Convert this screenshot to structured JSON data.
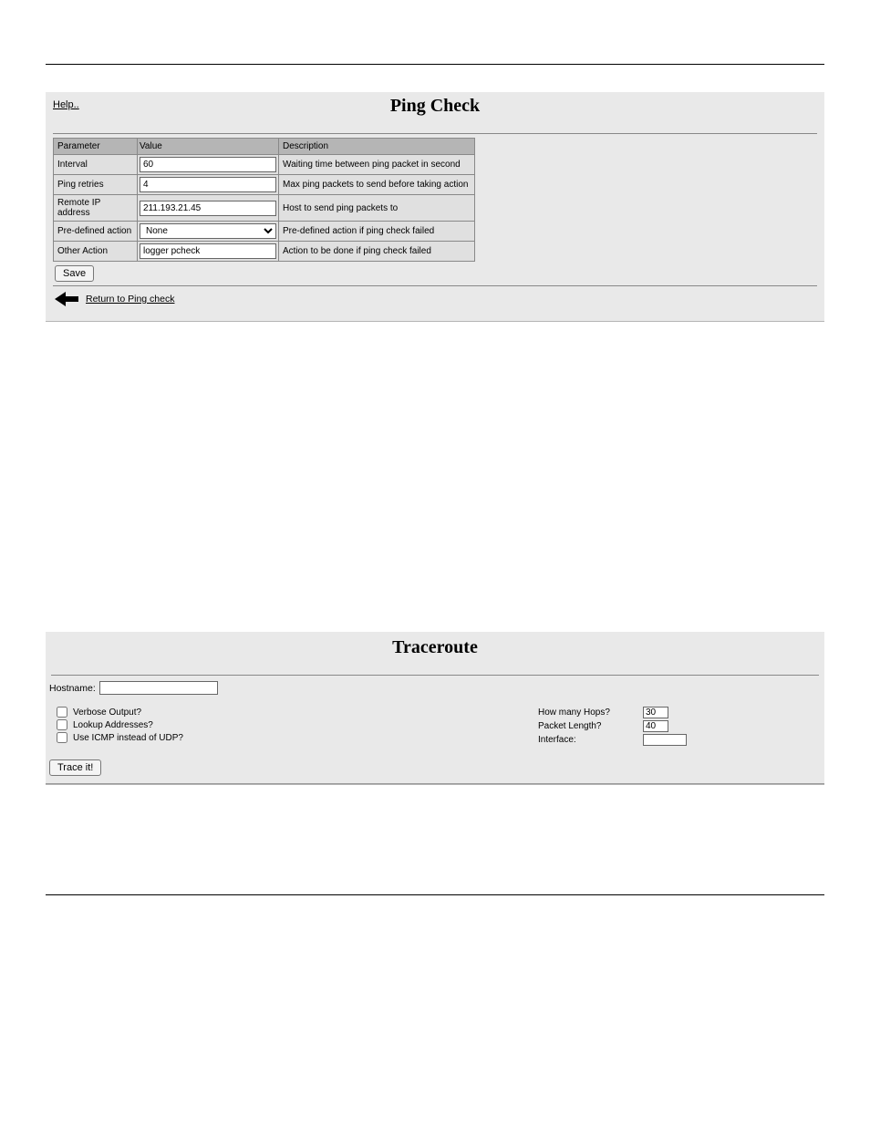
{
  "ping": {
    "help": "Help..",
    "title": "Ping Check",
    "headers": {
      "param": "Parameter",
      "value": "Value",
      "desc": "Description"
    },
    "rows": [
      {
        "param": "Interval",
        "value": "60",
        "type": "text",
        "desc": "Waiting time between ping packet in second"
      },
      {
        "param": "Ping retries",
        "value": "4",
        "type": "text",
        "desc": "Max ping packets to send before taking action"
      },
      {
        "param": "Remote IP address",
        "value": "211.193.21.45",
        "type": "text",
        "desc": "Host to send ping packets to"
      },
      {
        "param": "Pre-defined action",
        "value": "None",
        "type": "select",
        "desc": "Pre-defined action if ping check failed"
      },
      {
        "param": "Other Action",
        "value": "logger pcheck",
        "type": "text",
        "desc": "Action to be done if ping check failed"
      }
    ],
    "save": "Save",
    "return": "Return to Ping check"
  },
  "trace": {
    "title": "Traceroute",
    "hostname_label": "Hostname:",
    "hostname_value": "",
    "cb_verbose": "Verbose Output?",
    "cb_lookup": "Lookup Addresses?",
    "cb_icmp": "Use ICMP instead of UDP?",
    "hops_label": "How many Hops?",
    "hops_value": "30",
    "packet_label": "Packet Length?",
    "packet_value": "40",
    "iface_label": "Interface:",
    "iface_value": "",
    "trace_btn": "Trace it!"
  }
}
